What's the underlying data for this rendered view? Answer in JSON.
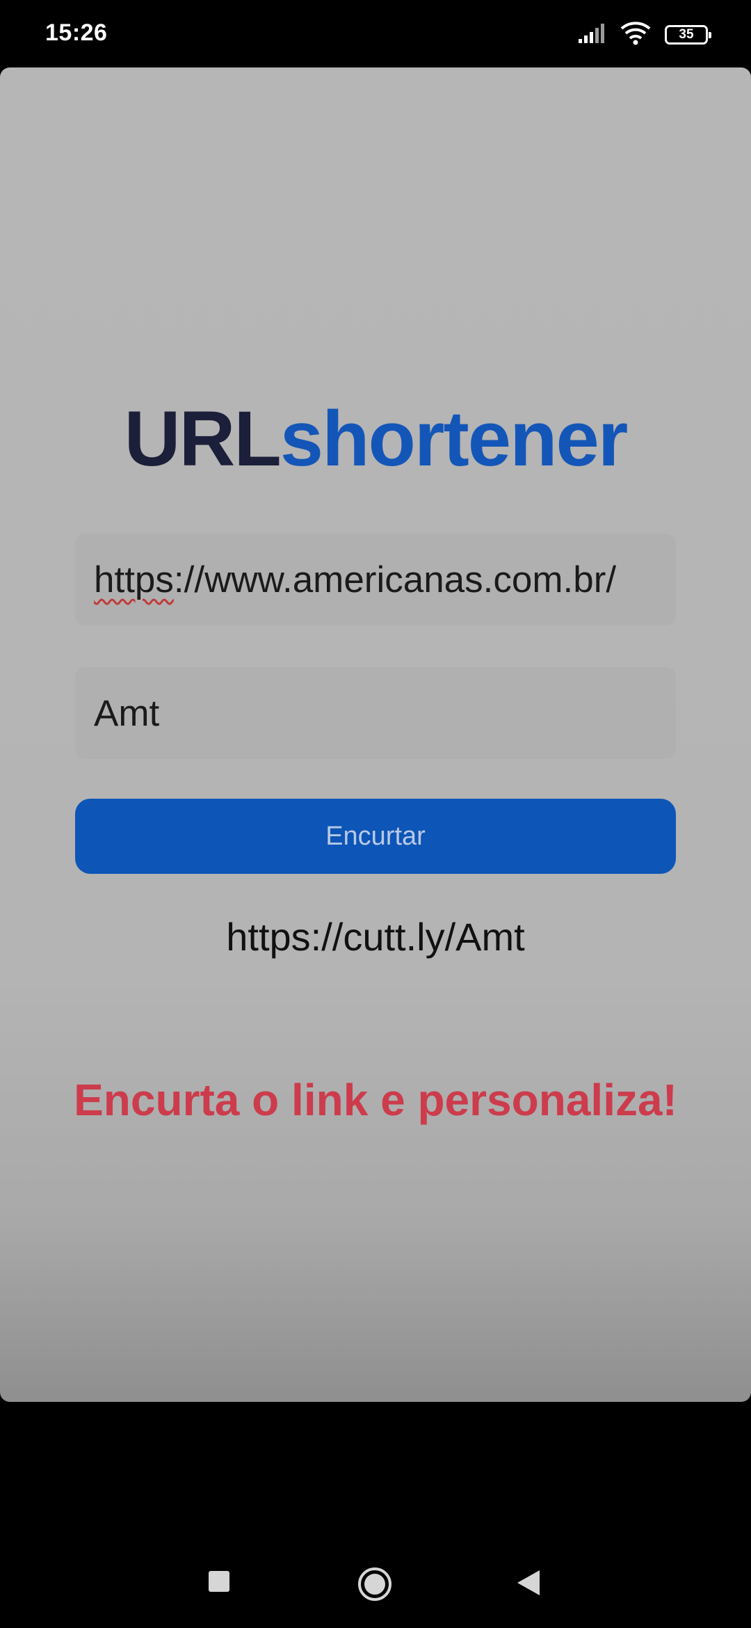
{
  "status_bar": {
    "time": "15:26",
    "battery_level": "35",
    "icons": [
      "signal-icon",
      "wifi-icon",
      "battery-icon"
    ]
  },
  "app": {
    "title_part1": "URL",
    "title_part2": "shortener",
    "url_input": {
      "value_underlined": "https",
      "value_rest": "://www.americanas.com.br/"
    },
    "alias_input": {
      "value": "Amt"
    },
    "shorten_button_label": "Encurtar",
    "result_link": "https://cutt.ly/Amt",
    "tagline": "Encurta o link e personaliza!"
  },
  "nav_bar": {
    "icons": [
      "recents-icon",
      "home-icon",
      "back-icon"
    ]
  },
  "colors": {
    "title_dark": "#1c1f3a",
    "title_blue": "#1456b8",
    "button": "#0d55b7",
    "tagline": "#cc3c4c"
  }
}
